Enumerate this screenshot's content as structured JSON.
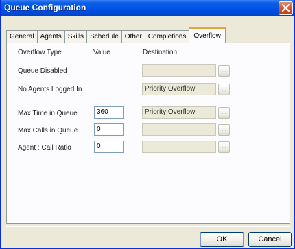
{
  "window": {
    "title": "Queue Configuration"
  },
  "tabs": [
    {
      "label": "General"
    },
    {
      "label": "Agents"
    },
    {
      "label": "Skills"
    },
    {
      "label": "Schedule"
    },
    {
      "label": "Other"
    },
    {
      "label": "Completions"
    },
    {
      "label": "Overflow",
      "active": true
    }
  ],
  "headers": {
    "type": "Overflow Type",
    "value": "Value",
    "destination": "Destination"
  },
  "rows": [
    {
      "label": "Queue Disabled",
      "value": null,
      "destination": "",
      "browse": "..."
    },
    {
      "label": "No Agents Logged In",
      "value": null,
      "destination": "Priority Overflow",
      "browse": "..."
    },
    {
      "label": "Max Time in Queue",
      "value": "360",
      "destination": "Priority Overflow",
      "browse": "..."
    },
    {
      "label": "Max Calls in Queue",
      "value": "0",
      "destination": "",
      "browse": "..."
    },
    {
      "label": "Agent : Call Ratio",
      "value": "0",
      "destination": "",
      "browse": "..."
    }
  ],
  "buttons": {
    "ok": "OK",
    "cancel": "Cancel"
  },
  "colors": {
    "titlebar": "#0055e5",
    "close": "#d9532d",
    "active_tab_accent": "#e8a33d"
  },
  "icons": {
    "close": "close-icon"
  }
}
